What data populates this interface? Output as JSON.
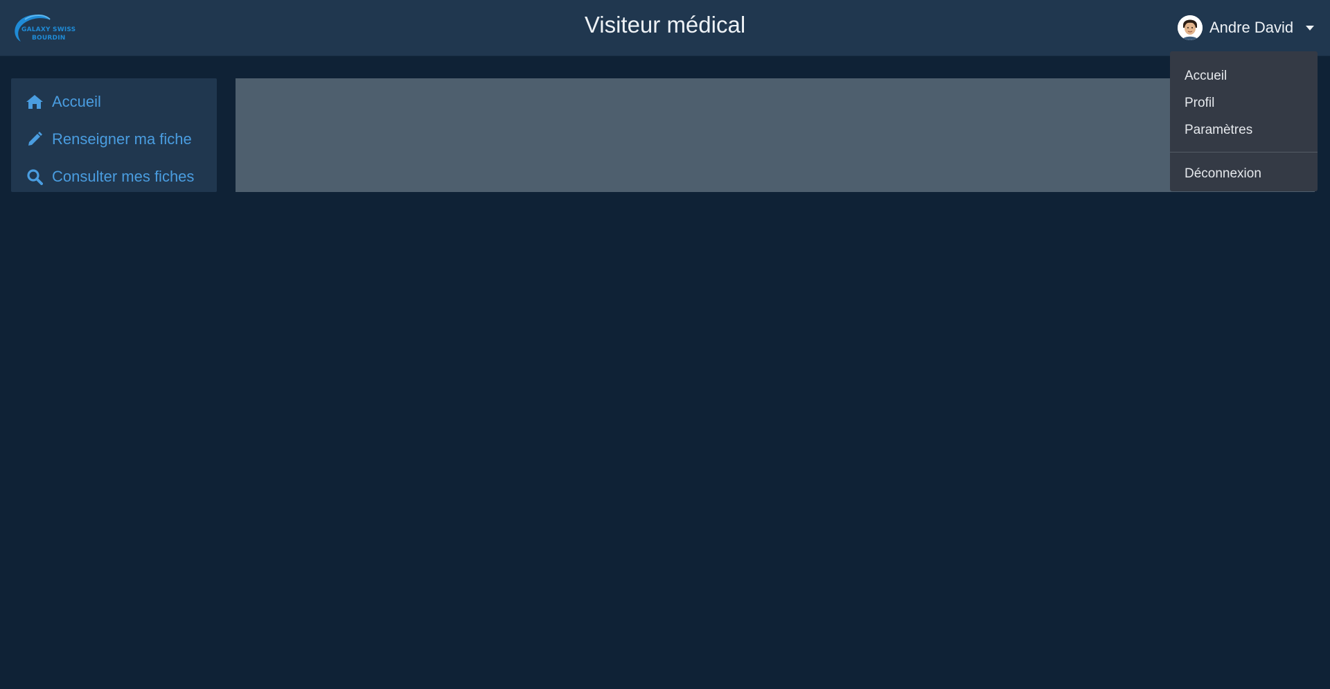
{
  "header": {
    "logo_text_line1": "GALAXY SWISS",
    "logo_text_line2": "BOURDIN",
    "title": "Visiteur médical",
    "user_name": "Andre David"
  },
  "user_dropdown": {
    "items": [
      {
        "label": "Accueil"
      },
      {
        "label": "Profil"
      },
      {
        "label": "Paramètres"
      }
    ],
    "logout_label": "Déconnexion"
  },
  "sidebar": {
    "items": [
      {
        "label": "Accueil",
        "icon": "home-icon"
      },
      {
        "label": "Renseigner ma fiche",
        "icon": "pencil-icon"
      },
      {
        "label": "Consulter mes fiches",
        "icon": "search-icon"
      }
    ]
  },
  "colors": {
    "background": "#0f2236",
    "header": "#20374f",
    "sidebar": "#20374f",
    "link": "#4a9de0",
    "content_panel": "#4e5f6e",
    "dropdown": "#343a45"
  }
}
